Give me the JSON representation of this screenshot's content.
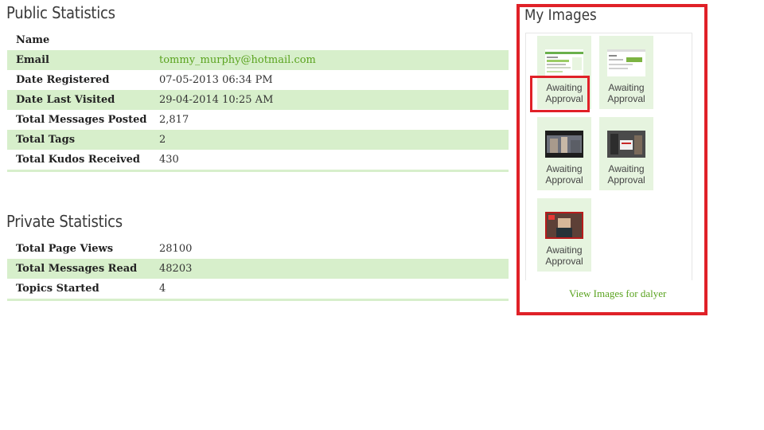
{
  "public_stats": {
    "title": "Public Statistics",
    "rows": [
      {
        "label": "Name",
        "value": ""
      },
      {
        "label": "Email",
        "value": "tommy_murphy@hotmail.com"
      },
      {
        "label": "Date Registered",
        "value": "07-05-2013 06:34 PM"
      },
      {
        "label": "Date Last Visited",
        "value": "29-04-2014 10:25 AM"
      },
      {
        "label": "Total Messages Posted",
        "value": "2,817"
      },
      {
        "label": "Total Tags",
        "value": "2"
      },
      {
        "label": "Total Kudos Received",
        "value": "430"
      }
    ]
  },
  "private_stats": {
    "title": "Private Statistics",
    "rows": [
      {
        "label": "Total Page Views",
        "value": "28100"
      },
      {
        "label": "Total Messages Read",
        "value": "48203"
      },
      {
        "label": "Topics Started",
        "value": "4"
      }
    ]
  },
  "my_images": {
    "title": "My Images",
    "tiles": [
      {
        "caption": "Awaiting Approval"
      },
      {
        "caption": "Awaiting Approval"
      },
      {
        "caption": "Awaiting Approval"
      },
      {
        "caption": "Awaiting Approval"
      },
      {
        "caption": "Awaiting Approval"
      }
    ],
    "view_link": "View Images for dalyer"
  },
  "colors": {
    "accent_green": "#5aa31f",
    "row_stripe": "#d7efcb",
    "highlight_red": "#e02128"
  }
}
